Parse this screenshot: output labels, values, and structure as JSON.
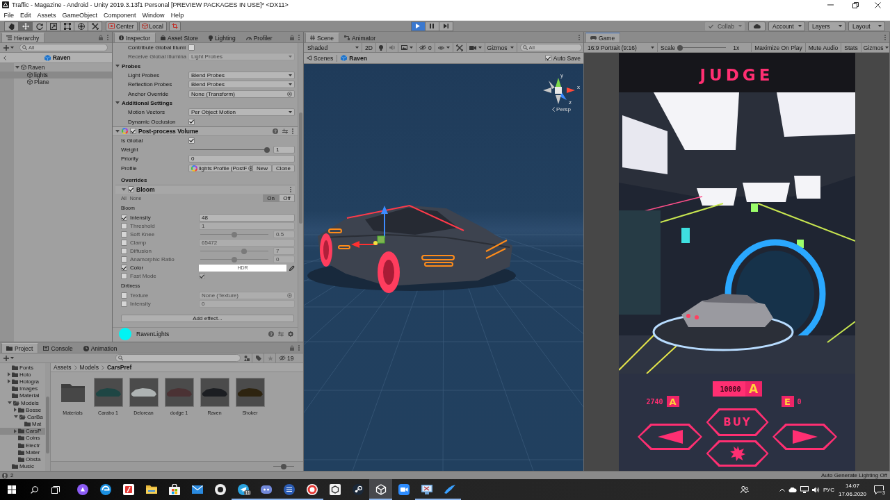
{
  "window": {
    "title": "Traffic - Magazine - Android - Unity 2019.3.13f1 Personal [PREVIEW PACKAGES IN USE]* <DX11>"
  },
  "menu": [
    "File",
    "Edit",
    "Assets",
    "GameObject",
    "Component",
    "Window",
    "Help"
  ],
  "toolbar": {
    "tools": [
      {
        "kind": "hand",
        "selected": false
      },
      {
        "kind": "move",
        "selected": true
      },
      {
        "kind": "rotate",
        "selected": false
      },
      {
        "kind": "scale",
        "selected": false
      },
      {
        "kind": "rect",
        "selected": false
      },
      {
        "kind": "transform",
        "selected": false
      },
      {
        "kind": "custom",
        "selected": false
      }
    ],
    "pivot": "Center",
    "space": "Local",
    "playback": [
      {
        "kind": "play",
        "on": true
      },
      {
        "kind": "pause",
        "on": false
      },
      {
        "kind": "step",
        "on": false
      }
    ],
    "collab": {
      "label": "Collab",
      "disabled": true
    },
    "account": "Account",
    "layers": "Layers",
    "layout": "Layout"
  },
  "hierarchy": {
    "tab": {
      "label": "Hierarchy",
      "selected": true
    },
    "search_placeholder": "All",
    "scene": "Raven",
    "tree": [
      {
        "label": "Raven",
        "expanded": true,
        "selected": false,
        "children": [
          {
            "label": "lights",
            "selected": true
          },
          {
            "label": "Plane",
            "selected": false
          }
        ]
      }
    ]
  },
  "inspector": {
    "tabs": [
      {
        "label": "Inspector",
        "selected": true
      },
      {
        "label": "Asset Store",
        "selected": false
      },
      {
        "label": "Lighting",
        "selected": false
      },
      {
        "label": "Profiler",
        "selected": false
      }
    ],
    "renderer_rows": [
      {
        "kind": "toggle",
        "label": "Contribute Global Illumi",
        "checked": false
      },
      {
        "kind": "dropdown",
        "label": "Receive Global Illumina",
        "value": "Light Probes",
        "disabled": true
      },
      {
        "kind": "section",
        "label": "Probes",
        "expanded": true,
        "children": [
          {
            "kind": "dropdown",
            "label": "Light Probes",
            "value": "Blend Probes",
            "disabled": false
          },
          {
            "kind": "dropdown",
            "label": "Reflection Probes",
            "value": "Blend Probes",
            "disabled": false
          },
          {
            "kind": "object",
            "label": "Anchor Override",
            "value": "None (Transform)"
          }
        ]
      },
      {
        "kind": "section",
        "label": "Additional Settings",
        "expanded": true,
        "children": [
          {
            "kind": "dropdown",
            "label": "Motion Vectors",
            "value": "Per Object Motion",
            "disabled": false
          },
          {
            "kind": "toggle",
            "label": "Dynamic Occlusion",
            "checked": true
          }
        ]
      }
    ],
    "volume": {
      "title": "Post-process Volume",
      "enabled": true,
      "expanded": true,
      "rows": [
        {
          "kind": "toggle",
          "label": "Is Global",
          "checked": true
        },
        {
          "kind": "slider",
          "label": "Weight",
          "level": 1,
          "value": "1"
        },
        {
          "kind": "field",
          "label": "Priority",
          "value": "0"
        },
        {
          "kind": "profile",
          "label": "Profile",
          "value": "lights Profile (PostF",
          "buttons": [
            "New",
            "Clone"
          ]
        }
      ]
    },
    "overrides": "Overrides",
    "effect": {
      "title": "Bloom",
      "enabled": true,
      "expanded": true,
      "all": "All",
      "none": "None",
      "modes": [
        {
          "label": "On",
          "selected": true
        },
        {
          "label": "Off",
          "selected": false
        }
      ],
      "groups": [
        {
          "label": "Bloom",
          "rows": [
            {
              "kind": "field",
              "label": "Intensity",
              "override": true,
              "value": "48"
            },
            {
              "kind": "field",
              "label": "Threshold",
              "override": false,
              "value": "1"
            },
            {
              "kind": "slider",
              "label": "Soft Knee",
              "override": false,
              "level": 0.5,
              "value": "0.5"
            },
            {
              "kind": "field",
              "label": "Clamp",
              "override": false,
              "value": "65472"
            },
            {
              "kind": "slider",
              "label": "Diffusion",
              "override": false,
              "level": 0.65,
              "value": "7"
            },
            {
              "kind": "slider",
              "label": "Anamorphic Ratio",
              "override": false,
              "level": 0.5,
              "value": "0"
            },
            {
              "kind": "color",
              "label": "Color",
              "override": true,
              "value": "HDR",
              "color": "#ffffff"
            },
            {
              "kind": "toggle",
              "label": "Fast Mode",
              "override": false,
              "checked": true
            }
          ]
        },
        {
          "label": "Dirtiness",
          "rows": [
            {
              "kind": "object",
              "label": "Texture",
              "override": false,
              "value": "None (Texture)"
            },
            {
              "kind": "field",
              "label": "Intensity",
              "override": false,
              "value": "0"
            }
          ]
        }
      ]
    },
    "add_effect": "Add effect...",
    "script": {
      "title": "RavenLights"
    }
  },
  "scene": {
    "tabs": [
      {
        "label": "Scene",
        "selected": true
      },
      {
        "label": "Animator",
        "selected": false
      }
    ],
    "shading": "Shaded",
    "mode_2d": {
      "label": "2D",
      "on": false
    },
    "hidden_count": "0",
    "gizmos": "Gizmos",
    "search_placeholder": "All",
    "breadcrumb": [
      "Scenes",
      "Raven"
    ],
    "auto_save": {
      "label": "Auto Save",
      "checked": true
    },
    "axes": [
      "y",
      "x",
      "z"
    ],
    "projection": "Persp"
  },
  "game": {
    "tab": {
      "label": "Game",
      "selected": true
    },
    "aspect": "16:9 Portrait (9:16)",
    "scale": {
      "label": "Scale",
      "level": 0,
      "value": "1x"
    },
    "toggles": [
      {
        "label": "Maximize On Play",
        "on": false
      },
      {
        "label": "Mute Audio",
        "on": false
      },
      {
        "label": "Stats",
        "on": false
      }
    ],
    "gizmos": "Gizmos",
    "hud": {
      "title": "JUDGE",
      "price": "10000",
      "price_symbol": "A",
      "coins": "2740",
      "coin_symbol": "A",
      "gem_symbol": "E",
      "gems": "0",
      "buy": "BUY"
    }
  },
  "project": {
    "tabs": [
      {
        "label": "Project",
        "selected": true
      },
      {
        "label": "Console",
        "selected": false
      },
      {
        "label": "Animation",
        "selected": false
      }
    ],
    "hidden_count": "19",
    "tree": [
      {
        "label": "Fonts",
        "selected": false
      },
      {
        "label": "Holo",
        "expanded": false,
        "selected": false
      },
      {
        "label": "Hologra",
        "expanded": false,
        "selected": false
      },
      {
        "label": "Images",
        "selected": false
      },
      {
        "label": "Material",
        "selected": false
      },
      {
        "label": "Models",
        "expanded": true,
        "selected": false,
        "children": [
          {
            "label": "Bosse",
            "expanded": false,
            "selected": false
          },
          {
            "label": "CarBa",
            "expanded": true,
            "selected": false,
            "children": [
              {
                "label": "Mat",
                "selected": false
              }
            ]
          },
          {
            "label": "CarsP",
            "expanded": false,
            "selected": true
          },
          {
            "label": "Coins",
            "selected": false
          },
          {
            "label": "Electr",
            "selected": false
          },
          {
            "label": "Mater",
            "selected": false
          },
          {
            "label": "Obsta",
            "selected": false
          }
        ]
      },
      {
        "label": "Music",
        "selected": false
      }
    ],
    "path": [
      "Assets",
      "Models",
      "CarsPref"
    ],
    "items": [
      {
        "kind": "folder",
        "label": "Materials"
      },
      {
        "kind": "prefab",
        "label": "Carabo 1",
        "color": "#1e4644"
      },
      {
        "kind": "prefab",
        "label": "Delorean",
        "color": "#aeb3b3"
      },
      {
        "kind": "prefab",
        "label": "dodge 1",
        "color": "#4b3234"
      },
      {
        "kind": "prefab",
        "label": "Raven",
        "color": "#1c1e22"
      },
      {
        "kind": "prefab",
        "label": "Shoker",
        "color": "#2e2410"
      }
    ],
    "icon_size": {
      "level": 0.5
    }
  },
  "status_bar": {
    "count": "2",
    "message": "Auto Generate Lighting Off"
  },
  "taskbar": {
    "apps": [
      {
        "kind": "ring",
        "active": false,
        "running": false
      },
      {
        "kind": "swirl",
        "active": false,
        "running": false
      },
      {
        "kind": "tile",
        "active": false,
        "running": false
      },
      {
        "kind": "folder",
        "active": false,
        "running": false
      },
      {
        "kind": "bag",
        "active": false,
        "running": false
      },
      {
        "kind": "envelope",
        "active": false,
        "running": false
      },
      {
        "kind": "disc",
        "active": false,
        "running": false
      },
      {
        "kind": "plane",
        "active": false,
        "running": true,
        "badge": "11"
      },
      {
        "kind": "controller",
        "active": false,
        "running": true
      },
      {
        "kind": "doc",
        "active": false,
        "running": true
      },
      {
        "kind": "circle",
        "active": false,
        "running": true
      },
      {
        "kind": "box",
        "active": false,
        "running": false
      },
      {
        "kind": "steam",
        "active": false,
        "running": false
      },
      {
        "kind": "cube",
        "active": true,
        "running": true
      },
      {
        "kind": "camera",
        "active": false,
        "running": false
      },
      {
        "kind": "monitor",
        "active": false,
        "running": true
      },
      {
        "kind": "swoosh",
        "active": false,
        "running": true
      }
    ],
    "tray": {
      "language": "РУС",
      "time": "14:07",
      "date": "17.06.2020",
      "notifications": "3"
    }
  }
}
